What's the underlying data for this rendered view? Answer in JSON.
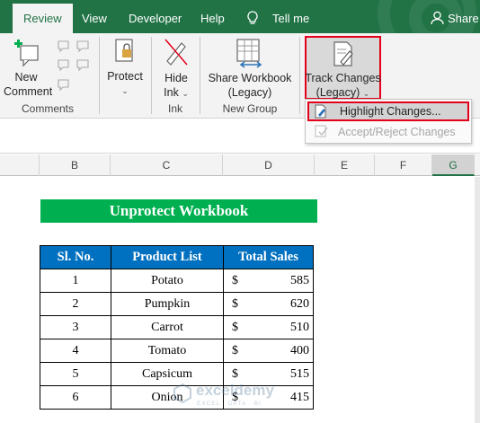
{
  "tabs": {
    "review": "Review",
    "view": "View",
    "developer": "Developer",
    "help": "Help",
    "tell_me": "Tell me",
    "share": "Share"
  },
  "ribbon": {
    "new_comment_line1": "New",
    "new_comment_line2": "Comment",
    "comments_group": "Comments",
    "protect": "Protect",
    "hide_ink_line1": "Hide",
    "hide_ink_line2": "Ink",
    "ink_group": "Ink",
    "share_workbook_line1": "Share Workbook",
    "share_workbook_line2": "(Legacy)",
    "new_group": "New Group",
    "track_changes_line1": "Track Changes",
    "track_changes_line2": "(Legacy)"
  },
  "menu": {
    "highlight_changes": "Highlight Changes...",
    "accept_reject": "Accept/Reject Changes"
  },
  "columns": [
    "B",
    "C",
    "D",
    "E",
    "F",
    "G"
  ],
  "sheet": {
    "banner": "Unprotect Workbook",
    "headers": [
      "Sl. No.",
      "Product List",
      "Total Sales"
    ],
    "rows": [
      {
        "sl": "1",
        "product": "Potato",
        "currency": "$",
        "sales": "585"
      },
      {
        "sl": "2",
        "product": "Pumpkin",
        "currency": "$",
        "sales": "620"
      },
      {
        "sl": "3",
        "product": "Carrot",
        "currency": "$",
        "sales": "510"
      },
      {
        "sl": "4",
        "product": "Tomato",
        "currency": "$",
        "sales": "400"
      },
      {
        "sl": "5",
        "product": "Capsicum",
        "currency": "$",
        "sales": "515"
      },
      {
        "sl": "6",
        "product": "Onion",
        "currency": "$",
        "sales": "415"
      }
    ]
  },
  "watermark": {
    "name": "exceldemy",
    "tagline": "EXCEL · DATA · BI"
  },
  "colors": {
    "excel_green": "#217346",
    "banner_green": "#00b050",
    "header_blue": "#0070c0",
    "highlight_red": "#e3001b"
  }
}
